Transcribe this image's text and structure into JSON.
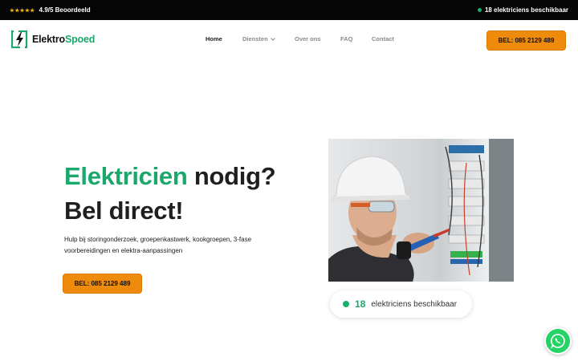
{
  "topbar": {
    "stars": "★★★★★",
    "rating_text": "4.9/5 Beoordeeld",
    "availability_text": "18 elektriciens beschikbaar"
  },
  "logo": {
    "part1": "Elektro",
    "part2": "Spoed"
  },
  "nav": {
    "items": [
      {
        "label": "Home",
        "active": true
      },
      {
        "label": "Diensten",
        "has_dropdown": true
      },
      {
        "label": "Over ons"
      },
      {
        "label": "FAQ"
      },
      {
        "label": "Contact"
      }
    ],
    "call_button": "BEL: 085 2129 489"
  },
  "hero": {
    "title_green": "Elektricien",
    "title_rest": "nodig?",
    "title_line2": "Bel direct!",
    "subtitle_line1": "Hulp bij storingonderzoek, groepenkastwerk, kookgroepen, 3-fase",
    "subtitle_line2": "voorbereidingen en elektra-aanpassingen",
    "call_button": "BEL: 085 2129 489",
    "availability_count": "18",
    "availability_label": "elektriciens beschikbaar"
  },
  "colors": {
    "accent_green": "#1aa86b",
    "button_orange": "#ee8a0c",
    "topbar_bg": "#050505",
    "whatsapp_green": "#25d366"
  },
  "icons": [
    "star-icon",
    "status-dot-icon",
    "logo-bolt-icon",
    "chevron-down-icon",
    "whatsapp-icon"
  ]
}
